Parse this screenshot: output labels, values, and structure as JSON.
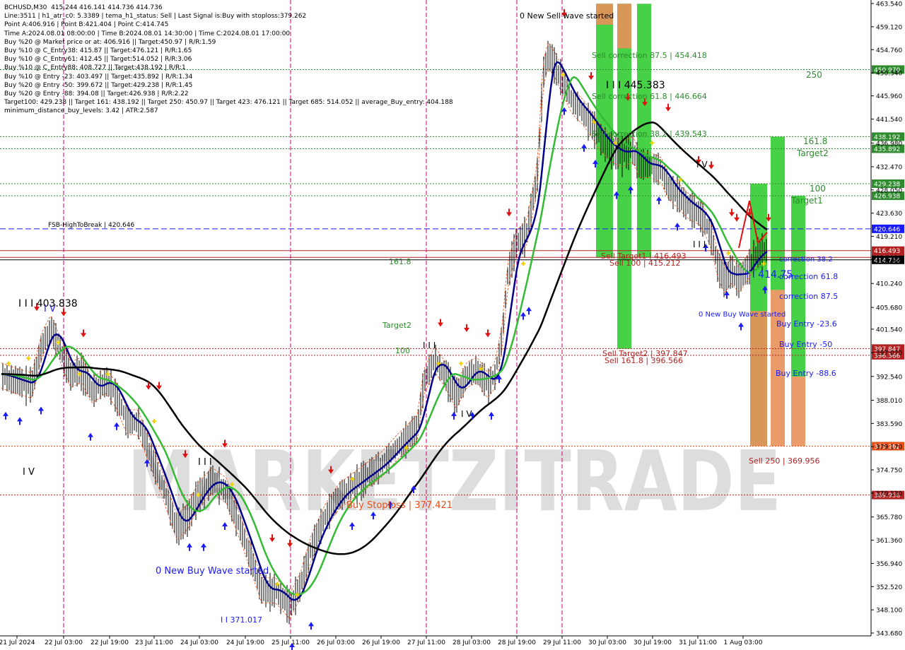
{
  "header": {
    "info_lines": [
      "BCHUSD,M30  415.244 416.141 414.736 414.736",
      "Line:3511 | h1_atr_c0: 5.3389 | tema_h1_status: Sell | Last Signal is:Buy with stoploss:379.262",
      "Point A:406.916 | Point B:421.404 | Point C:414.745",
      "Time A:2024.08.01 08:00:00 | Time B:2024.08.01 14:30:00 | Time C:2024.08.01 17:00:00",
      "Buy %20 @ Market price or at: 406.916 || Target:450.97 | R/R:1.59",
      "Buy %10 @ C_Entry38: 415.87 || Target:476.121 | R/R:1.65",
      "Buy %10 @ C_Entry61: 412.45 || Target:514.052 | R/R:3.06",
      "Buy %10 @ C_Entry88: 408.727 || Target:438.192 | R/R:1",
      "Buy %10 @ Entry -23: 403.497 || Target:435.892 | R/R:1.34",
      "Buy %20 @ Entry -50: 399.672 || Target:429.238 | R/R:1.45",
      "Buy %20 @ Entry -88: 394.08 || Target:426.938 | R/R:2.22",
      "Target100: 429.238 || Target 161: 438.192 || Target 250: 450.97 || Target 423: 476.121 || Target 685: 514.052 || average_Buy_entry: 404.188",
      "minimum_distance_buy_levels: 3.42 | ATR:2.587"
    ]
  },
  "watermark": "MARKETZITRADE",
  "chart_data": {
    "type": "candlestick",
    "symbol": "BCHUSD",
    "timeframe": "M30",
    "ylim": [
      343.68,
      463.54
    ],
    "price_ticks": [
      "463.540",
      "459.120",
      "454.760",
      "450.340",
      "445.960",
      "441.540",
      "436.980",
      "432.470",
      "428.050",
      "423.630",
      "419.210",
      "414.780",
      "410.240",
      "405.680",
      "401.540",
      "397.070",
      "392.540",
      "388.010",
      "383.590",
      "379.170",
      "374.750",
      "370.330",
      "365.780",
      "361.360",
      "356.940",
      "352.520",
      "348.100",
      "343.680"
    ],
    "time_labels": [
      "21 Jul 2024",
      "22 Jul 03:00",
      "22 Jul 19:00",
      "23 Jul 11:00",
      "24 Jul 03:00",
      "24 Jul 19:00",
      "25 Jul 11:00",
      "26 Jul 03:00",
      "26 Jul 19:00",
      "27 Jul 11:00",
      "28 Jul 03:00",
      "28 Jul 19:00",
      "29 Jul 11:00",
      "30 Jul 03:00",
      "30 Jul 19:00",
      "31 Jul 11:00",
      "1 Aug 03:00"
    ],
    "hlines": [
      {
        "price": 450.97,
        "label": "450.970",
        "color": "#2e8b2e",
        "style": "dotted"
      },
      {
        "price": 438.192,
        "label": "438.192",
        "color": "#2e8b2e",
        "style": "dotted"
      },
      {
        "price": 435.892,
        "label": "435.892",
        "color": "#2e8b2e",
        "style": "dotted"
      },
      {
        "price": 429.238,
        "label": "429.238",
        "color": "#2e8b2e",
        "style": "dotted"
      },
      {
        "price": 426.938,
        "label": "426.938",
        "color": "#2e8b2e",
        "style": "dotted"
      },
      {
        "price": 420.646,
        "label": "420.646",
        "color": "#1a1aff",
        "style": "dashed"
      },
      {
        "price": 416.493,
        "label": "416.493",
        "color": "#b22222",
        "style": "solid"
      },
      {
        "price": 415.212,
        "label": "415.212",
        "color": "#b22222",
        "style": "solid"
      },
      {
        "price": 414.736,
        "label": "414.736",
        "color": "#000000",
        "style": "solid"
      },
      {
        "price": 397.847,
        "label": "397.847",
        "color": "#b22222",
        "style": "dotted"
      },
      {
        "price": 396.566,
        "label": "396.566",
        "color": "#b22222",
        "style": "dotted"
      },
      {
        "price": 379.262,
        "label": "379.262",
        "color": "#e8501a",
        "style": "dotted"
      },
      {
        "price": 369.956,
        "label": "369.956",
        "color": "#b22222",
        "style": "dotted"
      }
    ],
    "vlines_times": [
      "22 Jul 03:00",
      "25 Jul 11:00",
      "27 Jul 11:00",
      "28 Jul 19:00",
      "29 Jul 11:00"
    ],
    "labels": [
      {
        "text": "FSB-HighToBreak | 420.646",
        "color": "#000000"
      },
      {
        "text": "0 New Sell wave started",
        "color": "#000000"
      },
      {
        "text": "Sell correction 87.5 | 454.418",
        "color": "#2e8b2e"
      },
      {
        "text": "I I I 445.383",
        "color": "#000000"
      },
      {
        "text": "Sell correction 61.8 | 446.664",
        "color": "#2e8b2e"
      },
      {
        "text": "Sell correction 38.2 | 439.543",
        "color": "#2e8b2e"
      },
      {
        "text": "250",
        "color": "#2e8b2e"
      },
      {
        "text": "161.8",
        "color": "#2e8b2e"
      },
      {
        "text": "Target2",
        "color": "#2e8b2e"
      },
      {
        "text": "100",
        "color": "#2e8b2e"
      },
      {
        "text": "Target1",
        "color": "#2e8b2e"
      },
      {
        "text": "I V",
        "color": "#000000"
      },
      {
        "text": "I I I",
        "color": "#000000"
      },
      {
        "text": "Sell Target1 | 416.493",
        "color": "#b22222"
      },
      {
        "text": "Sell 100 | 415.212",
        "color": "#b22222"
      },
      {
        "text": "correction 38.2",
        "color": "#1a1aff"
      },
      {
        "text": "I I 414.75",
        "color": "#1a1aff"
      },
      {
        "text": "correction 61.8",
        "color": "#1a1aff"
      },
      {
        "text": "correction 87.5",
        "color": "#1a1aff"
      },
      {
        "text": "0 New Buy Wave started",
        "color": "#1a1aff"
      },
      {
        "text": "Buy Entry -23.6",
        "color": "#1a1aff"
      },
      {
        "text": "Buy Entry -50",
        "color": "#1a1aff"
      },
      {
        "text": "Buy Entry -88.6",
        "color": "#1a1aff"
      },
      {
        "text": "161.8",
        "color": "#2e8b2e"
      },
      {
        "text": "Target2",
        "color": "#2e8b2e"
      },
      {
        "text": "100",
        "color": "#2e8b2e"
      },
      {
        "text": "I I I",
        "color": "#000000"
      },
      {
        "text": "I V",
        "color": "#000000"
      },
      {
        "text": "Sell Target2 | 397.847",
        "color": "#b22222"
      },
      {
        "text": "Sell 161.8 | 396.566",
        "color": "#b22222"
      },
      {
        "text": "I I I 403.838",
        "color": "#000000"
      },
      {
        "text": "I V",
        "color": "#1a1aff"
      },
      {
        "text": "I V",
        "color": "#000000"
      },
      {
        "text": "I I I",
        "color": "#000000"
      },
      {
        "text": "0 New Buy Wave started",
        "color": "#1a1aff"
      },
      {
        "text": "I I 371.017",
        "color": "#1a1aff"
      },
      {
        "text": "Buy Stoploss | 377.421",
        "color": "#e8501a"
      },
      {
        "text": "Sell  250 | 369.956",
        "color": "#b22222"
      }
    ],
    "colors": {
      "bull_bar": "#33cc33",
      "bear_bar": "#e8905a",
      "ma_black": "#000000",
      "ma_green": "#33bb33",
      "ma_navy": "#00008b",
      "price_line_red": "#b22222",
      "dashed_blue": "#1a1aff",
      "vline_magenta": "#cc0077",
      "buy_arrow": "#1a1aff",
      "sell_arrow": "#e01010",
      "marker_yellow": "#f0d000"
    }
  }
}
